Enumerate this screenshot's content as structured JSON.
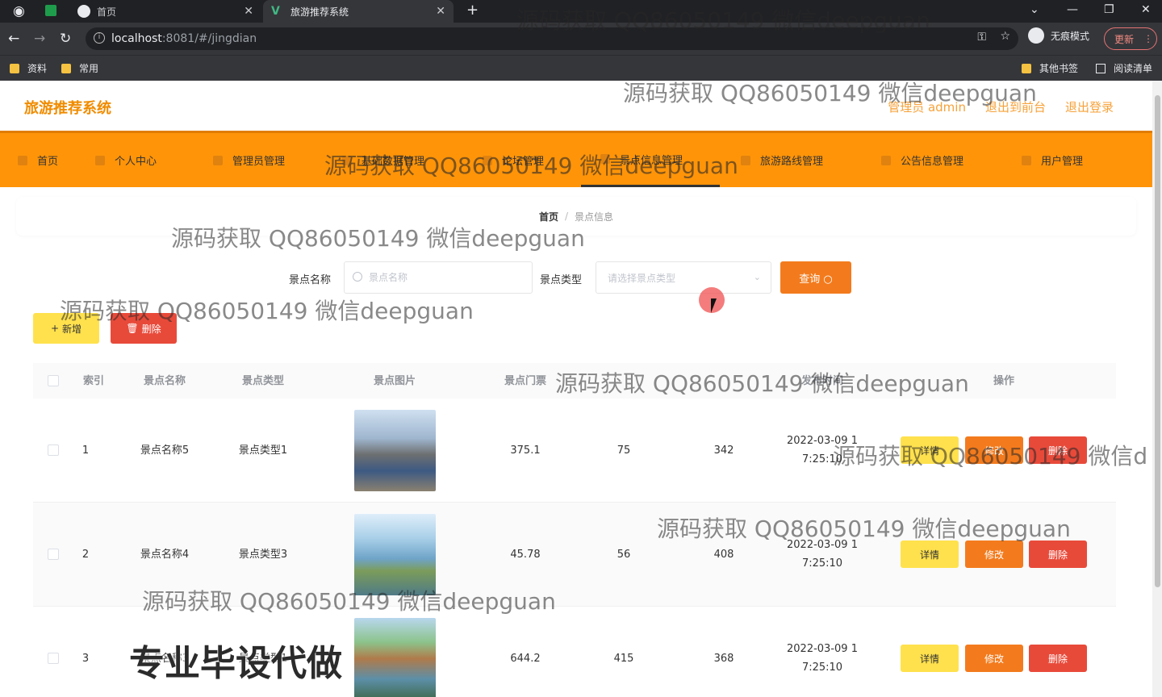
{
  "browser": {
    "tabs": [
      {
        "title": "首页"
      },
      {
        "title": "旅游推荐系统"
      }
    ],
    "url_host": "localhost",
    "url_rest": ":8081/#/jingdian",
    "profile_label": "无痕模式",
    "update_label": "更新",
    "bookmarks": [
      {
        "label": "资料"
      },
      {
        "label": "常用"
      },
      {
        "label": "其他书签"
      },
      {
        "label": "阅读清单"
      }
    ]
  },
  "app": {
    "logo": "旅游推荐系统",
    "header_links": [
      "管理员 admin",
      "退出到前台",
      "退出登录"
    ],
    "nav": [
      {
        "label": "首页"
      },
      {
        "label": "个人中心"
      },
      {
        "label": "管理员管理"
      },
      {
        "label": "基础数据管理"
      },
      {
        "label": "论坛管理"
      },
      {
        "label": "景点信息管理"
      },
      {
        "label": "旅游路线管理"
      },
      {
        "label": "公告信息管理"
      },
      {
        "label": "用户管理"
      }
    ],
    "active_nav": "景点信息管理",
    "accent_color": "#ff9408"
  },
  "breadcrumb": {
    "home": "首页",
    "sep": "/",
    "current": "景点信息"
  },
  "search": {
    "name_label": "景点名称",
    "name_placeholder": "景点名称",
    "type_label": "景点类型",
    "type_placeholder": "请选择景点类型",
    "query_label": "查询"
  },
  "actions": {
    "add_label": "新增",
    "delete_label": "删除"
  },
  "table": {
    "headers": [
      "索引",
      "景点名称",
      "景点类型",
      "景点图片",
      "景点门票",
      "",
      "",
      "发布时间",
      "操作"
    ],
    "rows": [
      {
        "index": "1",
        "name": "景点名称5",
        "type": "景点类型1",
        "ticket": "375.1",
        "c5": "75",
        "c6": "342",
        "date": "2022-03-09 1",
        "time": "7:25:10"
      },
      {
        "index": "2",
        "name": "景点名称4",
        "type": "景点类型3",
        "ticket": "45.78",
        "c5": "56",
        "c6": "408",
        "date": "2022-03-09 1",
        "time": "7:25:10"
      },
      {
        "index": "3",
        "name": "景点名称3",
        "type": "景点类型1",
        "ticket": "644.2",
        "c5": "415",
        "c6": "368",
        "date": "2022-03-09 1",
        "time": "7:25:10"
      }
    ],
    "row_buttons": {
      "detail": "详情",
      "edit": "修改",
      "remove": "删除"
    }
  },
  "overlay": {
    "watermark": "源码获取 QQ86050149 微信deepguan",
    "watermark_cut": "源码获取 QQ86050149 微信d",
    "promo": "专业毕设代做"
  }
}
